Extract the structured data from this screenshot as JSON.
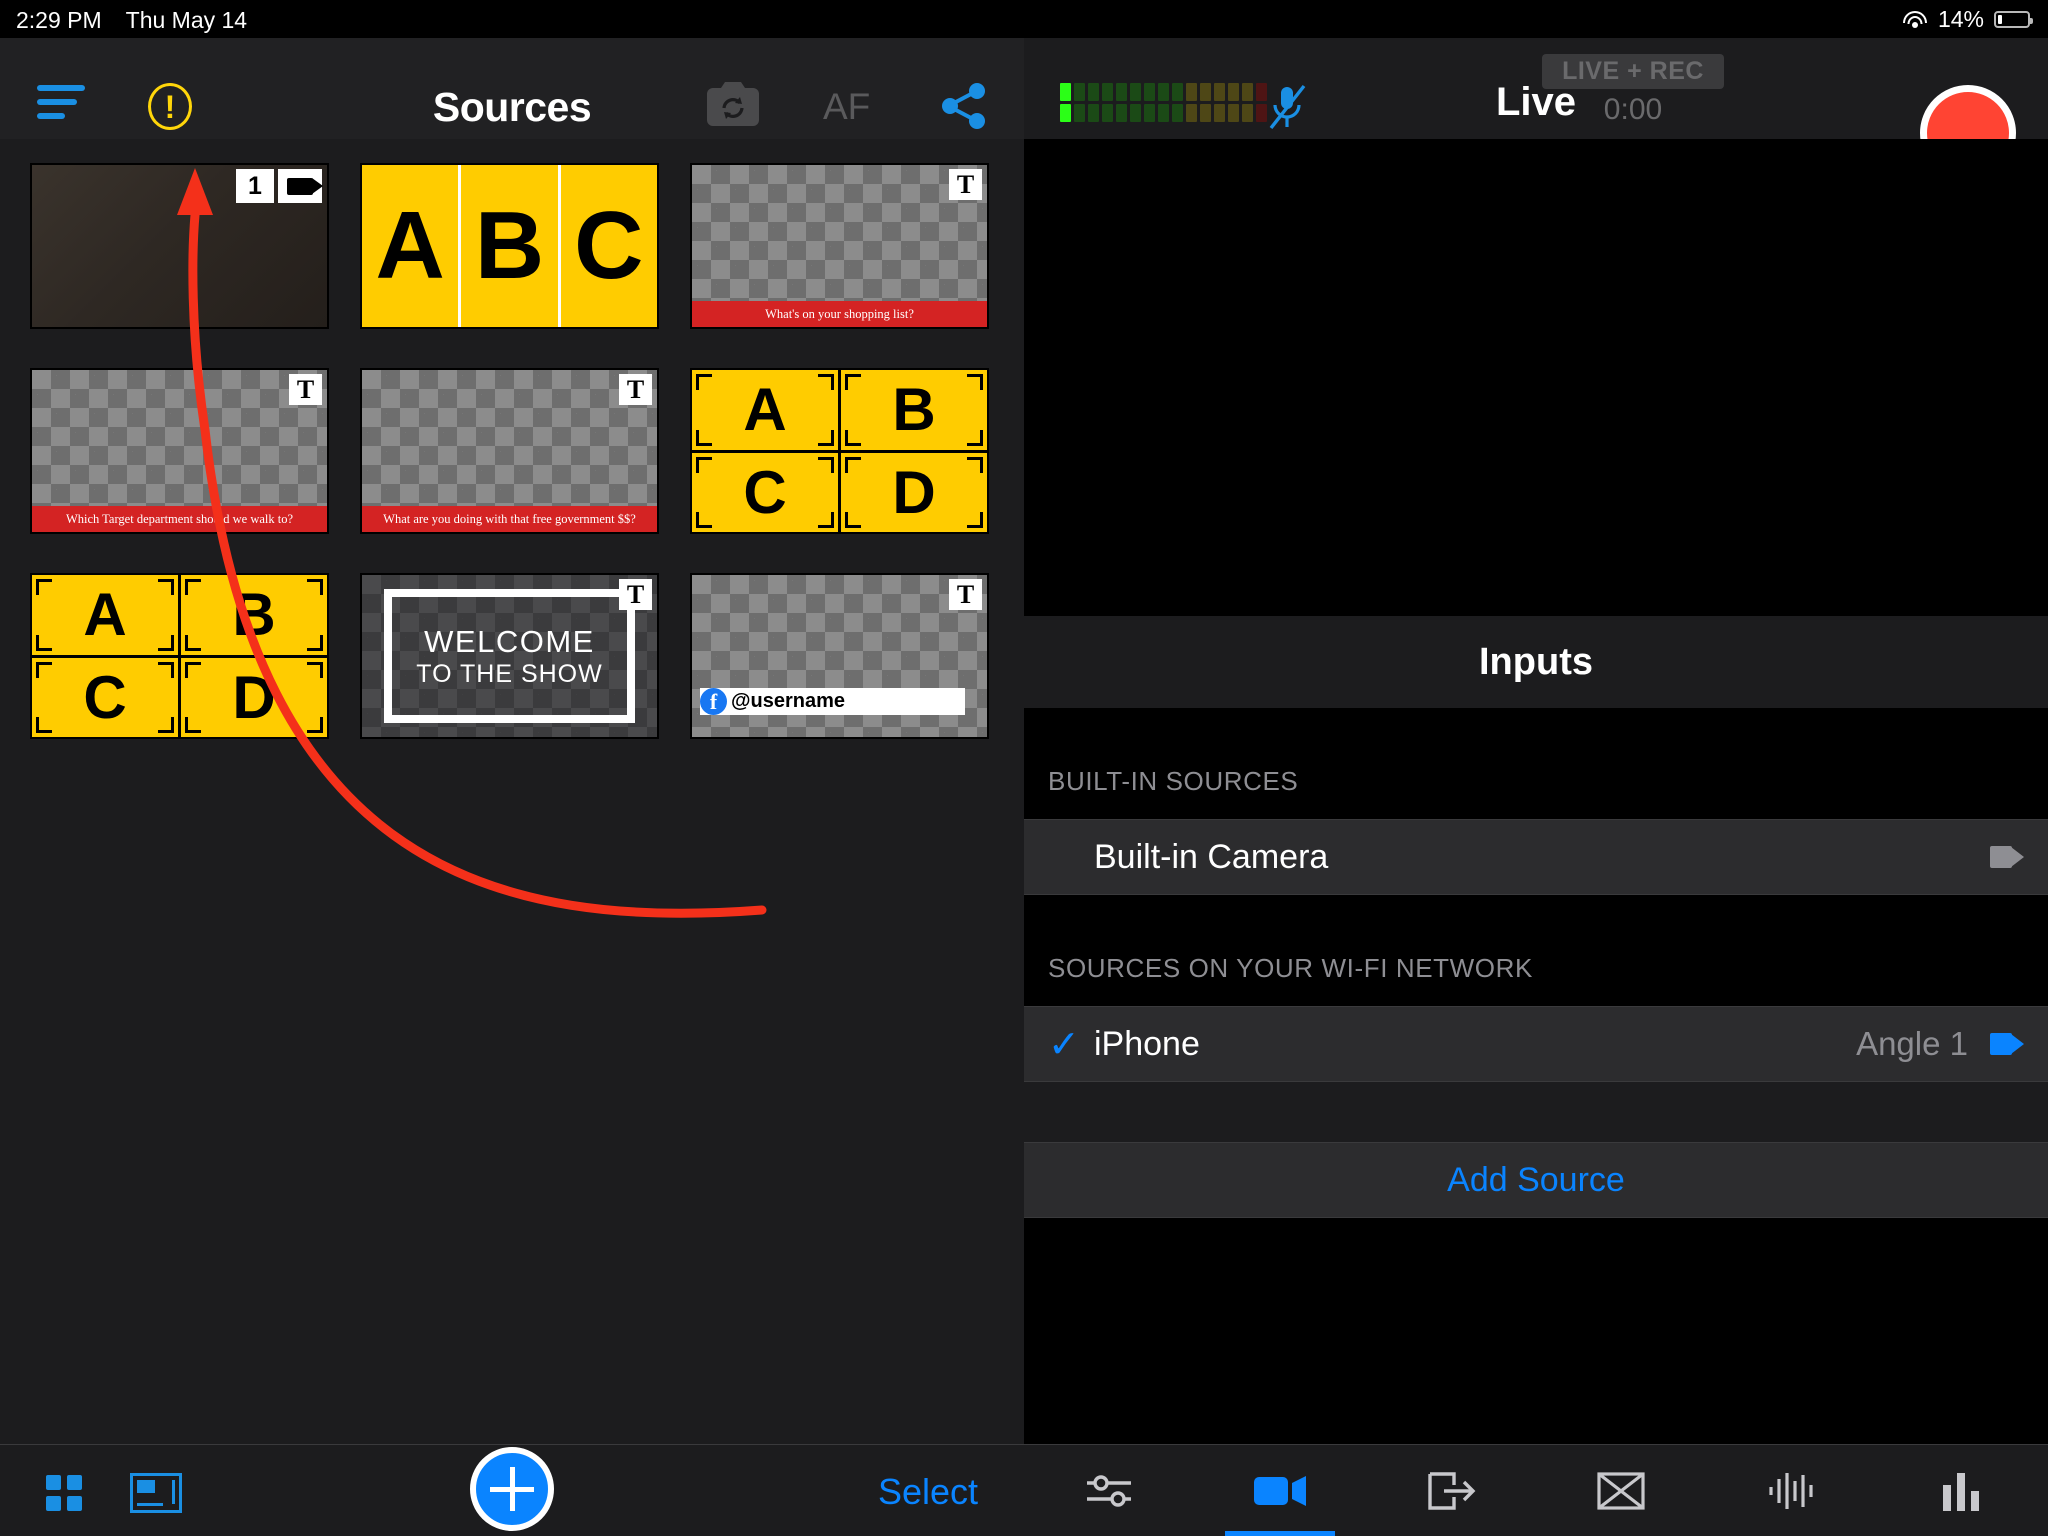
{
  "statusbar": {
    "time": "2:29 PM",
    "date": "Thu May 14",
    "battery_percent": "14%",
    "wifi_icon": "wifi-icon",
    "battery_icon": "battery-icon"
  },
  "left_panel": {
    "header": {
      "menu_icon": "hamburger-menu-icon",
      "warning_icon": "warning-exclamation-icon",
      "warning_glyph": "!",
      "title": "Sources",
      "camera_flip_icon": "camera-flip-icon",
      "af_label": "AF",
      "share_icon": "share-icon"
    },
    "sources": [
      {
        "id": "camera-source",
        "kind": "video",
        "number_badge": "1",
        "camera_badge_icon": "video-camera-icon"
      },
      {
        "id": "abc-bars",
        "kind": "abc",
        "letters": [
          "A",
          "B",
          "C"
        ]
      },
      {
        "id": "lower-third-shopping",
        "kind": "text",
        "t_badge": "T",
        "caption": "What's on your shopping list?"
      },
      {
        "id": "lower-third-target",
        "kind": "text",
        "t_badge": "T",
        "caption": "Which Target department should we walk to?"
      },
      {
        "id": "lower-third-government",
        "kind": "text",
        "t_badge": "T",
        "caption": "What are you doing with that free government $$?"
      },
      {
        "id": "abcd-quad-1",
        "kind": "quad",
        "letters": [
          "A",
          "B",
          "C",
          "D"
        ]
      },
      {
        "id": "abcd-quad-2",
        "kind": "quad",
        "letters": [
          "A",
          "B",
          "C",
          "D"
        ]
      },
      {
        "id": "welcome-slate",
        "kind": "welcome",
        "t_badge": "T",
        "line1": "WELCOME",
        "line2": "TO THE SHOW"
      },
      {
        "id": "username-lower-third",
        "kind": "username",
        "t_badge": "T",
        "platform_icon": "facebook-icon",
        "platform_glyph": "f",
        "username": "@username"
      }
    ],
    "bottom_bar": {
      "grid_icon": "grid-layout-icon",
      "layout_icon": "multiview-layout-icon",
      "add_icon": "plus-icon",
      "select_label": "Select"
    }
  },
  "right_panel": {
    "header": {
      "audio_meter_icon": "audio-level-meter",
      "meter_segments": 15,
      "meter_active": 1,
      "mic_icon": "microphone-muted-icon",
      "title": "Live",
      "live_rec_label": "LIVE + REC",
      "timer": "0:00",
      "record_icon": "record-button"
    },
    "inputs": {
      "title": "Inputs",
      "sections": [
        {
          "header": "BUILT-IN SOURCES",
          "rows": [
            {
              "name": "Built-in Camera",
              "checked": false,
              "angle": "",
              "camera_icon": "video-camera-icon",
              "camera_color": "#8e8e93"
            }
          ]
        },
        {
          "header": "SOURCES ON YOUR WI-FI NETWORK",
          "rows": [
            {
              "name": "iPhone",
              "checked": true,
              "check_glyph": "✓",
              "angle": "Angle 1",
              "camera_icon": "video-camera-icon",
              "camera_color": "#0a84ff"
            }
          ]
        }
      ],
      "add_source_label": "Add Source"
    },
    "tabs": [
      {
        "icon": "sliders-settings-icon",
        "active": false
      },
      {
        "icon": "video-camera-icon",
        "active": true
      },
      {
        "icon": "output-export-icon",
        "active": false
      },
      {
        "icon": "transition-icon",
        "active": false
      },
      {
        "icon": "audio-waveform-icon",
        "active": false
      },
      {
        "icon": "stats-bars-icon",
        "active": false
      }
    ]
  },
  "annotation": {
    "arrow_color": "#f4301a",
    "arrow_icon": "red-curved-arrow-annotation"
  },
  "colors": {
    "accent_blue": "#0a84ff",
    "record_red": "#ff4433",
    "yellow": "#ffcc00",
    "lower_third_red": "#d42323",
    "warning_yellow": "#ffd60a"
  }
}
